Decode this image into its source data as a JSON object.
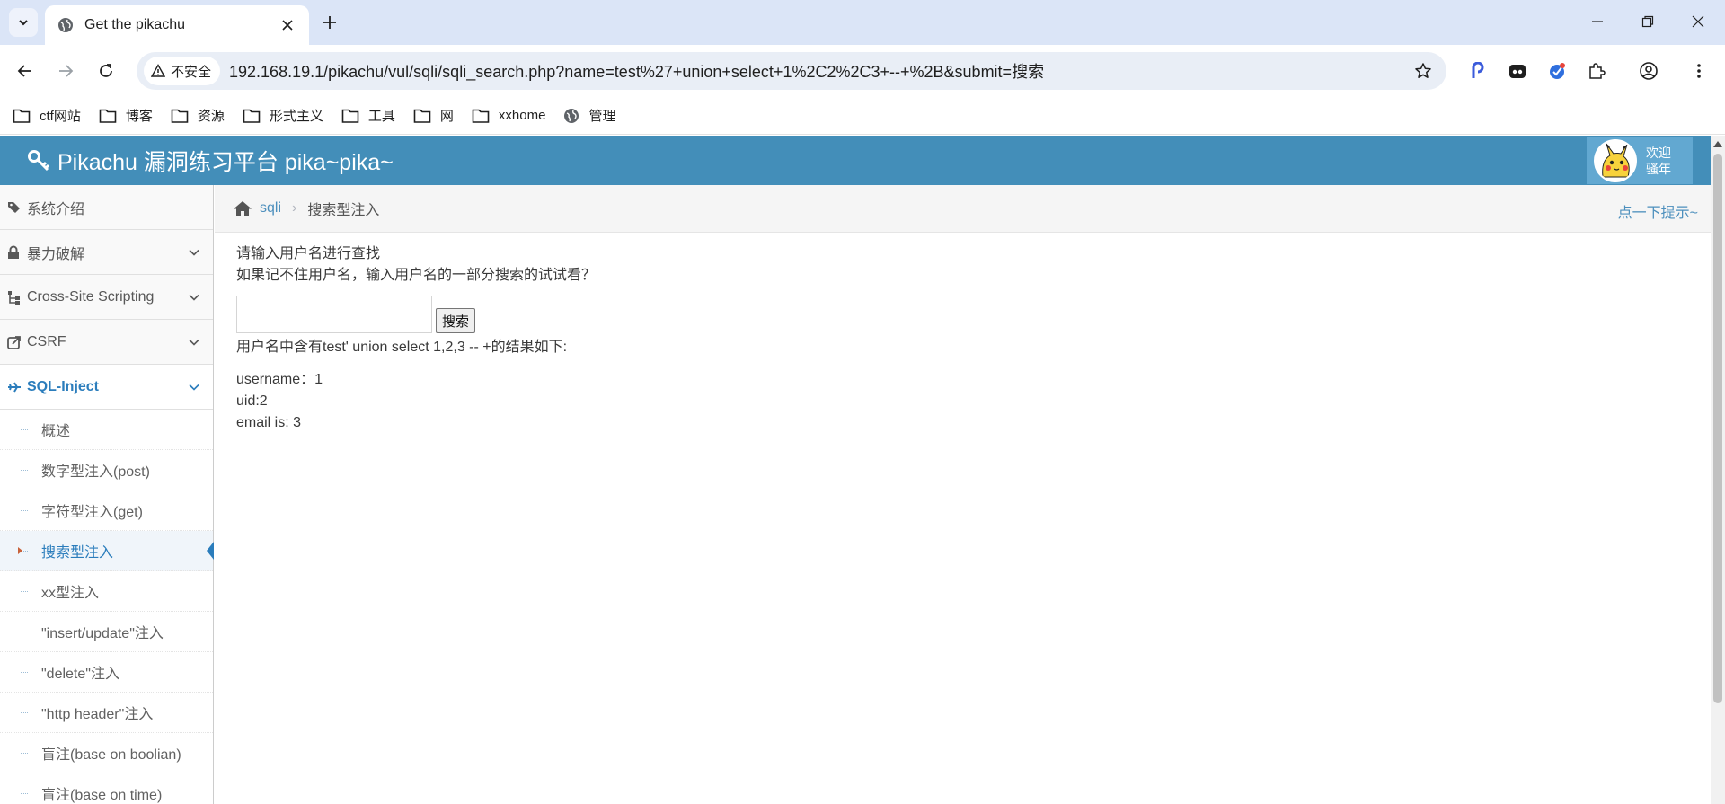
{
  "browser": {
    "tab_title": "Get the pikachu",
    "security_label": "不安全",
    "url": "192.168.19.1/pikachu/vul/sqli/sqli_search.php?name=test%27+union+select+1%2C2%2C3+--+%2B&submit=搜索",
    "bookmarks": [
      "ctf网站",
      "博客",
      "资源",
      "形式主义",
      "工具",
      "网",
      "xxhome",
      "管理"
    ]
  },
  "app": {
    "brand": "Pikachu 漏洞练习平台 pika~pika~",
    "welcome_line1": "欢迎",
    "welcome_line2": "骚年"
  },
  "sidebar": {
    "items": [
      {
        "label": "系统介绍",
        "icon": "tags-icon"
      },
      {
        "label": "暴力破解",
        "icon": "lock-icon"
      },
      {
        "label": "Cross-Site Scripting",
        "icon": "sitemap-icon"
      },
      {
        "label": "CSRF",
        "icon": "share-icon"
      },
      {
        "label": "SQL-Inject",
        "icon": "plane-icon"
      }
    ],
    "subitems": [
      "概述",
      "数字型注入(post)",
      "字符型注入(get)",
      "搜索型注入",
      "xx型注入",
      "\"insert/update\"注入",
      "\"delete\"注入",
      "\"http header\"注入",
      "盲注(base on boolian)",
      "盲注(base on time)"
    ]
  },
  "breadcrumb": {
    "link": "sqli",
    "current": "搜索型注入",
    "hint": "点一下提示~"
  },
  "content": {
    "prompt1": "请输入用户名进行查找",
    "prompt2": "如果记不住用户名，输入用户名的一部分搜索的试试看？",
    "search_value": "",
    "search_button": "搜索",
    "result_title": "用户名中含有test' union select 1,2,3 -- +的结果如下:",
    "username": "username：1",
    "uid": "uid:2",
    "email": "email is: 3"
  },
  "colors": {
    "navbar": "#438eb9",
    "link": "#4c8fbd",
    "active": "#2b7dbc",
    "tabbar": "#dbe5f7"
  }
}
